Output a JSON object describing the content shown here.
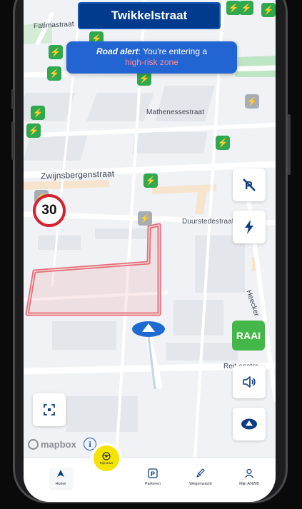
{
  "header": {
    "street_title": "Twikkelstraat"
  },
  "alert": {
    "prefix": "Road alert",
    "text": ": You're entering a",
    "zone": "high-risk zone"
  },
  "speed_limit": "30",
  "streets": {
    "fatimastraat": "Fatimastraat",
    "mathenesse": "Mathenessestraat",
    "zwijnsbergen": "Zwijnsbergenstraat",
    "duurstede": "Duurstedestraat",
    "heecker": "Heecker",
    "reit": "Reit   enstra"
  },
  "buttons": {
    "raai": "RAAI"
  },
  "mapbox": {
    "label": "mapbox",
    "info": "i"
  },
  "fab": {
    "label": "Rijmodus"
  },
  "nav": {
    "items": [
      {
        "label": "Home",
        "active": true
      },
      {
        "label": "Parkeren"
      },
      {
        "label": "Wegenwacht"
      },
      {
        "label": "Mijn ANWB"
      }
    ]
  },
  "colors": {
    "brand_blue": "#003b8e",
    "alert_blue": "#2264d1",
    "charger_green": "#2fa84f",
    "raai_green": "#45b649",
    "risk_zone_red": "#e4707a",
    "fab_yellow": "#f5e300"
  },
  "icons": {
    "charger": "lightning-icon",
    "no_parking": "no-parking-icon",
    "charging_filter": "lightning-icon",
    "sound": "speaker-icon",
    "recenter": "navigation-arrow-icon",
    "fullscreen": "fullscreen-corners-icon"
  }
}
